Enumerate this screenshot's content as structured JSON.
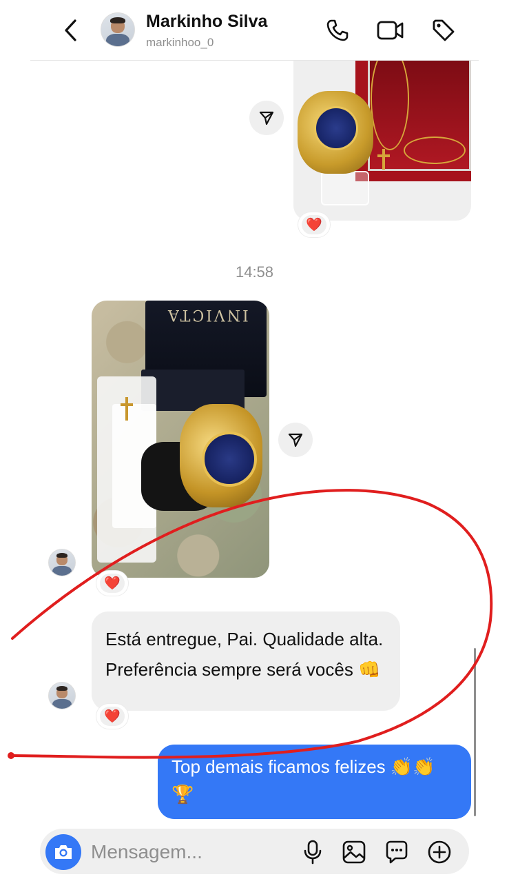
{
  "header": {
    "name": "Markinho Silva",
    "username": "markinhoo_0",
    "icons": [
      "back-icon",
      "phone-icon",
      "video-icon",
      "tag-icon"
    ]
  },
  "thread": {
    "timestamp": "14:58",
    "reaction": "❤️",
    "received_text": "Está entregue, Pai. Qualidade alta. Preferência sempre será vocês 👊",
    "sent_text": "Top demais ficamos felizes 👏👏🏆",
    "brand_text": "INVICTA"
  },
  "composer": {
    "placeholder": "Mensagem...",
    "icons": [
      "camera-icon",
      "microphone-icon",
      "gallery-icon",
      "sticker-icon",
      "plus-icon"
    ]
  },
  "colors": {
    "accent": "#3478f6",
    "bubble_in": "#efefef",
    "annotation": "#e01e1e"
  }
}
